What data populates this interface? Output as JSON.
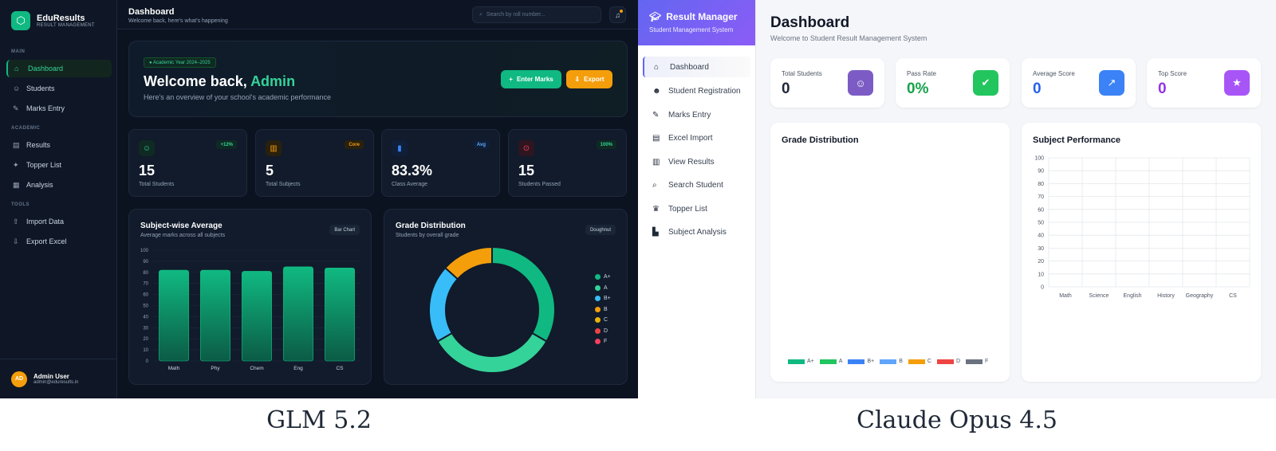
{
  "captions": {
    "left": "GLM 5.2",
    "right": "Claude Opus 4.5"
  },
  "left": {
    "brand": {
      "name": "EduResults",
      "sub": "RESULT MANAGEMENT"
    },
    "sections": {
      "main": "MAIN",
      "academic": "ACADEMIC",
      "tools": "TOOLS"
    },
    "nav": {
      "dashboard": "Dashboard",
      "students": "Students",
      "marks": "Marks Entry",
      "results": "Results",
      "topper": "Topper List",
      "analysis": "Analysis",
      "import": "Import Data",
      "export": "Export Excel"
    },
    "user": {
      "initials": "AD",
      "name": "Admin User",
      "email": "admin@eduresults.in"
    },
    "topbar": {
      "title": "Dashboard",
      "subtitle": "Welcome back, here's what's happening",
      "search_placeholder": "Search by roll number..."
    },
    "hero": {
      "badge": "● Academic Year 2024–2025",
      "welcome": "Welcome back, ",
      "name": "Admin",
      "subtitle": "Here's an overview of your school's academic performance",
      "enter_marks": "Enter Marks",
      "export": "Export"
    },
    "stats": [
      {
        "value": "15",
        "label": "Total Students",
        "tag": "+12%",
        "icon": "users-icon",
        "color": "#10b981"
      },
      {
        "value": "5",
        "label": "Total Subjects",
        "tag": "Core",
        "icon": "book-icon",
        "color": "#f59e0b"
      },
      {
        "value": "83.3%",
        "label": "Class Average",
        "tag": "Avg",
        "icon": "bar-chart-icon",
        "color": "#3b82f6"
      },
      {
        "value": "15",
        "label": "Students Passed",
        "tag": "100%",
        "icon": "check-circle-icon",
        "color": "#ef4444"
      }
    ],
    "bar_panel": {
      "title": "Subject-wise Average",
      "subtitle": "Average marks across all subjects",
      "chip": "Bar Chart"
    },
    "donut_panel": {
      "title": "Grade Distribution",
      "subtitle": "Students by overall grade",
      "chip": "Doughnut"
    }
  },
  "right": {
    "brand": {
      "title": "Result Manager",
      "sub": "Student Management System"
    },
    "nav": {
      "dashboard": "Dashboard",
      "registration": "Student Registration",
      "marks": "Marks Entry",
      "excel": "Excel Import",
      "view": "View Results",
      "search": "Search Student",
      "topper": "Topper List",
      "analysis": "Subject Analysis"
    },
    "title": "Dashboard",
    "subtitle": "Welcome to Student Result Management System",
    "stats": [
      {
        "label": "Total Students",
        "value": "0",
        "color": "#1f2937",
        "icon": "users-icon",
        "icon_bg": "#7c5cc4"
      },
      {
        "label": "Pass Rate",
        "value": "0%",
        "color": "#16a34a",
        "icon": "check-circle-icon",
        "icon_bg": "#22c55e"
      },
      {
        "label": "Average Score",
        "value": "0",
        "color": "#2563eb",
        "icon": "trend-chart-icon",
        "icon_bg": "#3b82f6"
      },
      {
        "label": "Top Score",
        "value": "0",
        "color": "#9333ea",
        "icon": "star-icon",
        "icon_bg": "#a855f7"
      }
    ],
    "grade_panel": {
      "title": "Grade Distribution"
    },
    "subject_panel": {
      "title": "Subject Performance"
    }
  },
  "chart_data": [
    {
      "type": "bar",
      "title": "Subject-wise Average",
      "categories": [
        "Math",
        "Phy",
        "Chem",
        "Eng",
        "CS"
      ],
      "values": [
        82,
        82,
        81,
        85,
        84
      ],
      "ylim": [
        0,
        100
      ],
      "yticks": [
        0,
        10,
        20,
        30,
        40,
        50,
        60,
        70,
        80,
        90,
        100
      ],
      "color": "#10b981"
    },
    {
      "type": "pie",
      "title": "Grade Distribution",
      "labels": [
        "A+",
        "A",
        "B+",
        "B",
        "C",
        "D",
        "F"
      ],
      "values": [
        5,
        5,
        3,
        2,
        0,
        0,
        0
      ],
      "colors": [
        "#10b981",
        "#34d399",
        "#38bdf8",
        "#f59e0b",
        "#eab308",
        "#ef4444",
        "#f43f5e"
      ]
    },
    {
      "type": "pie",
      "title": "Grade Distribution",
      "labels": [
        "A+",
        "A",
        "B+",
        "B",
        "C",
        "D",
        "F"
      ],
      "values": [
        0,
        0,
        0,
        0,
        0,
        0,
        0
      ],
      "colors": [
        "#10b981",
        "#22c55e",
        "#3b82f6",
        "#60a5fa",
        "#f59e0b",
        "#ef4444",
        "#6b7280"
      ]
    },
    {
      "type": "bar",
      "title": "Subject Performance",
      "categories": [
        "Math",
        "Science",
        "English",
        "History",
        "Geography",
        "CS"
      ],
      "values": [],
      "ylim": [
        0,
        100
      ],
      "yticks": [
        0,
        10,
        20,
        30,
        40,
        50,
        60,
        70,
        80,
        90,
        100
      ]
    }
  ]
}
